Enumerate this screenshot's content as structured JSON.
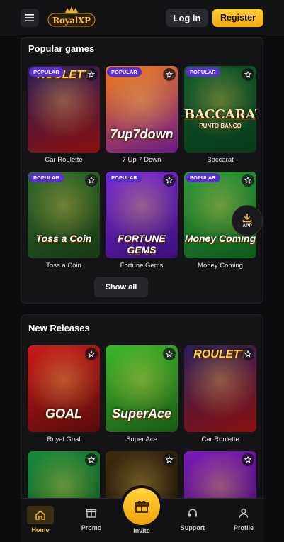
{
  "header": {
    "menu_icon": "hamburger-icon",
    "logo_text": "RoyalXP",
    "login_label": "Log in",
    "register_label": "Register",
    "accent": "#f5b825"
  },
  "popular": {
    "title": "Popular games",
    "badge": "POPULAR",
    "items": [
      {
        "label": "Car Roulette",
        "art": "ROULETT",
        "colors": [
          "#2a1f5a",
          "#8a1010"
        ]
      },
      {
        "label": "7 Up 7 Down",
        "art": "7up7down",
        "colors": [
          "#f27a1a",
          "#6a1a8a"
        ]
      },
      {
        "label": "Baccarat",
        "art": "BACCARAT",
        "sub": "PUNTO BANCO",
        "colors": [
          "#0e5a2a",
          "#08381a"
        ]
      },
      {
        "label": "Toss a Coin",
        "art": "Toss a Coin",
        "colors": [
          "#2f6a2a",
          "#173a14"
        ]
      },
      {
        "label": "Fortune Gems",
        "art": "FORTUNE GEMS",
        "colors": [
          "#7a2bd0",
          "#3a0f7a"
        ]
      },
      {
        "label": "Money Coming",
        "art": "Money Coming",
        "colors": [
          "#2a9a3a",
          "#0f5a1a"
        ]
      }
    ],
    "show_all_label": "Show all"
  },
  "app_fab": {
    "label": "APP",
    "icon": "download-icon"
  },
  "new_releases": {
    "title": "New Releases",
    "items": [
      {
        "label": "Royal Goal",
        "art": "GOAL",
        "colors": [
          "#c81a1a",
          "#5a0a0a"
        ]
      },
      {
        "label": "Super Ace",
        "art": "SuperAce",
        "colors": [
          "#3ab82a",
          "#1a5a14"
        ]
      },
      {
        "label": "Car Roulette",
        "art": "ROULETT",
        "colors": [
          "#2a1f5a",
          "#8a1010"
        ]
      },
      {
        "label": "",
        "art": "",
        "colors": [
          "#1a8a3a",
          "#0a4a1a"
        ]
      },
      {
        "label": "",
        "art": "",
        "colors": [
          "#3a2a10",
          "#120a04"
        ]
      },
      {
        "label": "",
        "art": "",
        "colors": [
          "#7a1ab8",
          "#3a0a5a"
        ]
      }
    ]
  },
  "nav": {
    "items": [
      {
        "label": "Home",
        "icon": "home-icon"
      },
      {
        "label": "Promo",
        "icon": "promo-icon"
      },
      {
        "label": "Invite",
        "icon": "gift-icon"
      },
      {
        "label": "Support",
        "icon": "headset-icon"
      },
      {
        "label": "Profile",
        "icon": "profile-icon"
      }
    ]
  }
}
